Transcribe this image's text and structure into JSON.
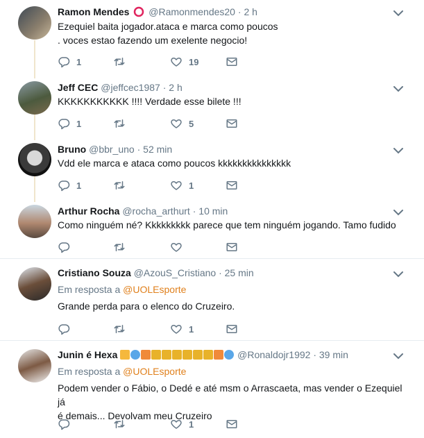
{
  "tweets": [
    {
      "name": "Ramon Mendes",
      "handle": "@Ramonmendes20",
      "time": "2 h",
      "text1": "Ezequiel baita jogador.ataca e marca como poucos",
      "text2": ". voces estao fazendo um exelente negocio!",
      "replies": "1",
      "retweets": "",
      "likes": "19"
    },
    {
      "name": "Jeff CEC",
      "handle": "@jeffcec1987",
      "time": "2 h",
      "text1": "KKKKKKKKKKK !!!! Verdade esse bilete !!!",
      "replies": "1",
      "retweets": "",
      "likes": "5"
    },
    {
      "name": "Bruno",
      "handle": "@bbr_uno",
      "time": "52 min",
      "text1": "Vdd ele marca e ataca como poucos kkkkkkkkkkkkkkk",
      "replies": "1",
      "retweets": "",
      "likes": "1"
    },
    {
      "name": "Arthur Rocha",
      "handle": "@rocha_arthurt",
      "time": "10 min",
      "text1": "Como ninguém né? Kkkkkkkkk parece que tem ninguém jogando. Tamo fudido",
      "replies": "",
      "retweets": "",
      "likes": ""
    },
    {
      "name": "Cristiano Souza",
      "handle": "@AzouS_Cristiano",
      "time": "25 min",
      "reply_prefix": "Em resposta a",
      "reply_to": "@UOLEsporte",
      "text1": "Grande perda para o elenco do Cruzeiro.",
      "replies": "",
      "retweets": "",
      "likes": "1"
    },
    {
      "name": "Junin é Hexa",
      "handle": "@Ronaldojr1992",
      "time": "39 min",
      "reply_prefix": "Em resposta a",
      "reply_to": "@UOLEsporte",
      "text1": "Podem vender o Fábio, o Dedé e até msm o Arrascaeta, mas vender o Ezequiel já",
      "text2": "é demais... Devolvam meu Cruzeiro",
      "replies": "",
      "retweets": "",
      "likes": "1"
    }
  ],
  "icons": {
    "reply": "reply-icon",
    "retweet": "retweet-icon",
    "like": "heart-icon",
    "dm": "envelope-icon",
    "menu": "chevron-down-icon"
  },
  "colors": {
    "link": "#e0801c",
    "muted": "#657786",
    "thread": "#f0e5cc"
  }
}
